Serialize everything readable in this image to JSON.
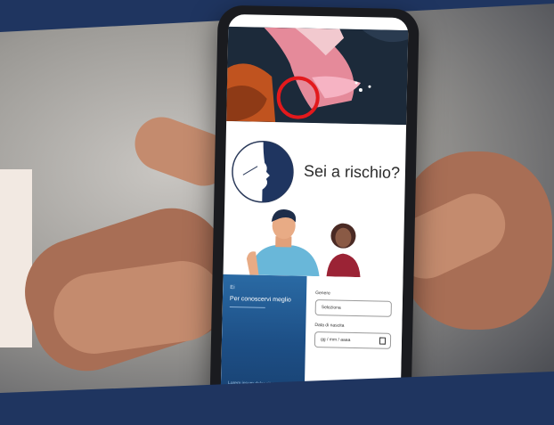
{
  "screen": {
    "risk_heading": "Sei a rischio?",
    "form_card": {
      "small_label": "Ei",
      "title": "Per conoscervi meglio",
      "footer_text": "Lorem ipsum dolor sit amet consectetur"
    },
    "form": {
      "first_field_label": "Genere",
      "first_field_value": "Seleziona",
      "second_field_label": "Data di nascita",
      "second_field_value": "gg / mm / aaaa"
    }
  },
  "colors": {
    "brand_navy": "#1f3560",
    "highlight_circle": "#e3191c",
    "card_blue": "#1d4f86"
  }
}
